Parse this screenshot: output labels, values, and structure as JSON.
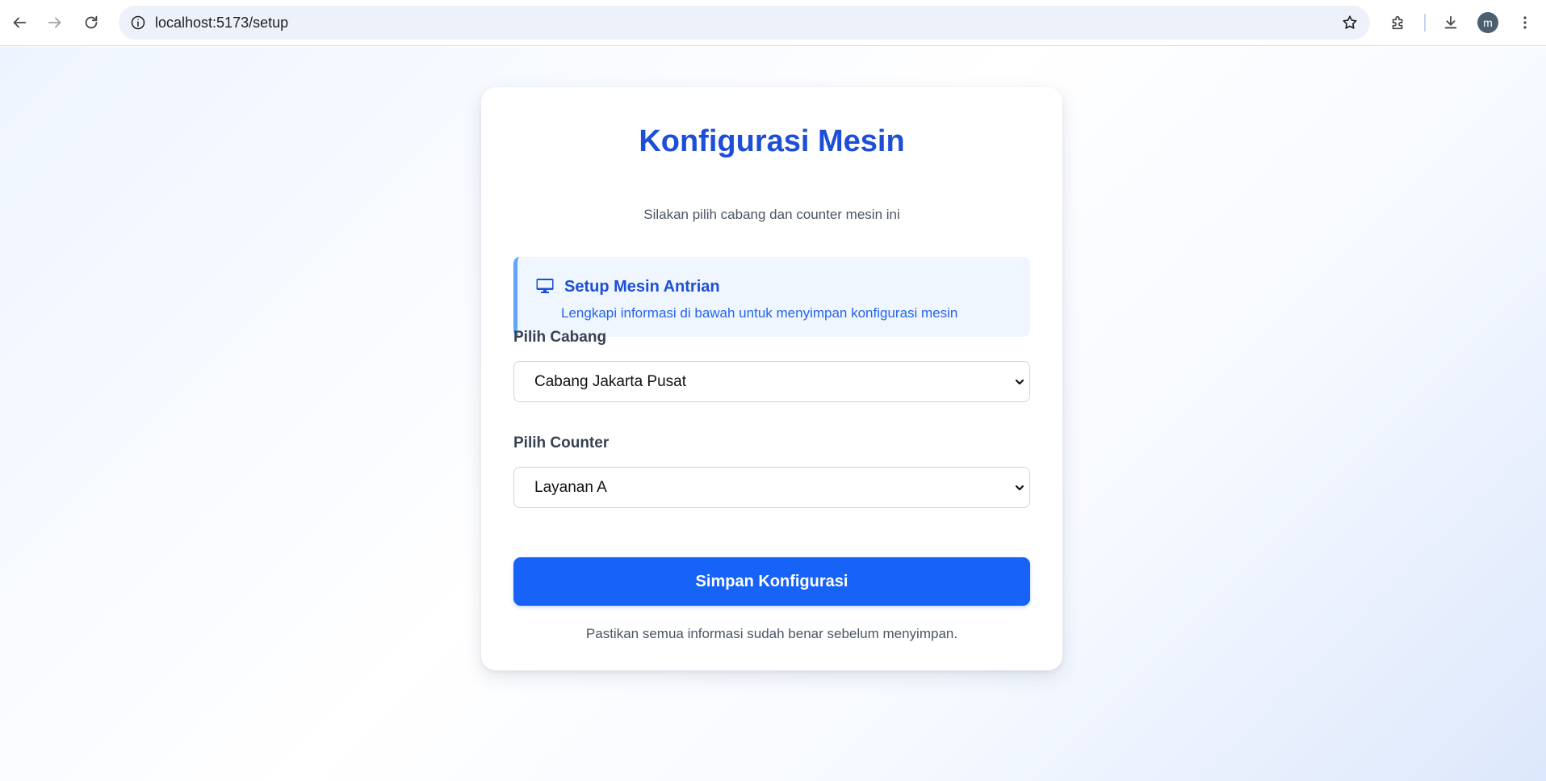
{
  "browser": {
    "url": "localhost:5173/setup",
    "profile_initial": "m",
    "icons": {
      "back": "back-arrow-icon",
      "forward": "forward-arrow-icon",
      "reload": "reload-icon",
      "site_info": "info-icon",
      "bookmark": "star-icon",
      "extensions": "puzzle-icon",
      "downloads": "download-icon",
      "menu": "kebab-menu-icon"
    }
  },
  "card": {
    "title": "Konfigurasi Mesin",
    "subtitle": "Silakan pilih cabang dan counter mesin ini",
    "info": {
      "icon": "monitor-icon",
      "title": "Setup Mesin Antrian",
      "description": "Lengkapi informasi di bawah untuk menyimpan konfigurasi mesin"
    },
    "branch": {
      "label": "Pilih Cabang",
      "selected": "Cabang Jakarta Pusat"
    },
    "counter": {
      "label": "Pilih Counter",
      "selected": "Layanan A"
    },
    "save_label": "Simpan Konfigurasi",
    "footnote": "Pastikan semua informasi sudah benar sebelum menyimpan."
  },
  "colors": {
    "primary": "#1763f7",
    "title": "#1d4ed8",
    "info_bg": "#eff6ff",
    "info_border": "#60a5fa"
  }
}
